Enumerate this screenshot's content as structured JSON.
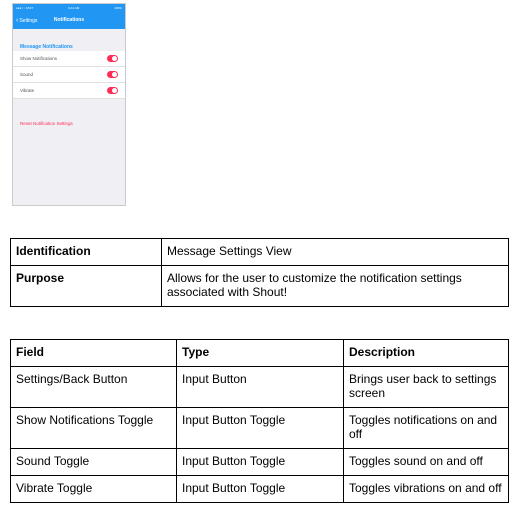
{
  "phone": {
    "status_left": "●●●○○ AT&T",
    "status_time": "9:41 AM",
    "status_right": "100%",
    "back_label": "Settings",
    "nav_title": "Notifications",
    "section_header": "Message Notifications",
    "rows": [
      {
        "label": "Show Notifications",
        "on": true
      },
      {
        "label": "Sound",
        "on": true
      },
      {
        "label": "Vibrate",
        "on": true
      }
    ],
    "reset_label": "Reset Notification Settings",
    "colors": {
      "nav": "#2196f3",
      "toggle": "#ff2d55",
      "background": "#efeff4"
    },
    "icons": {
      "back": "chevron-left-icon"
    }
  },
  "info_table": {
    "rows": [
      {
        "label": "Identification",
        "value": "Message Settings View"
      },
      {
        "label": "Purpose",
        "value": "Allows for the user to customize the notification settings associated with Shout!"
      }
    ]
  },
  "fields_table": {
    "headers": [
      "Field",
      "Type",
      "Description"
    ],
    "rows": [
      [
        "Settings/Back Button",
        "Input Button",
        "Brings user back to settings screen"
      ],
      [
        "Show Notifications Toggle",
        "Input Button Toggle",
        "Toggles notifications on and off"
      ],
      [
        "Sound Toggle",
        "Input Button Toggle",
        "Toggles sound on and off"
      ],
      [
        "Vibrate Toggle",
        "Input Button Toggle",
        "Toggles vibrations on and off"
      ]
    ]
  }
}
